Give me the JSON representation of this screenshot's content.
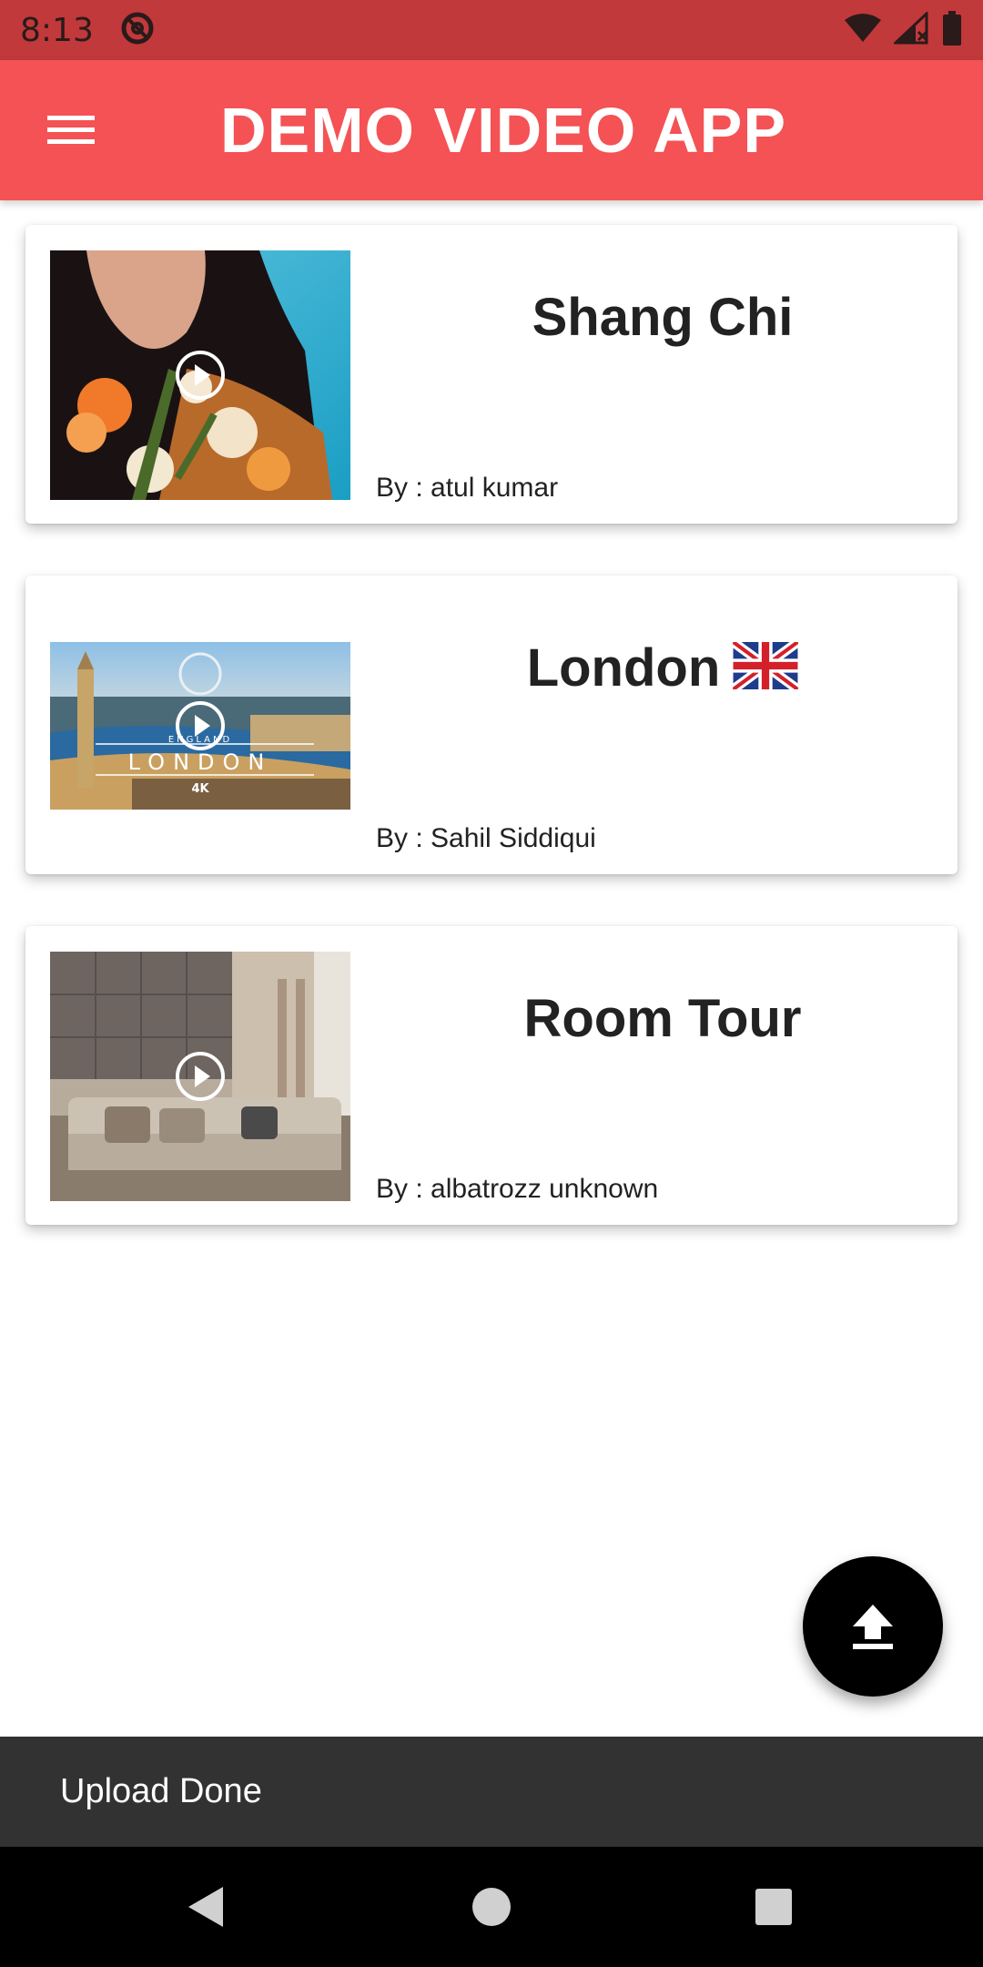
{
  "status_bar": {
    "time": "8:13",
    "icons": [
      "at-sign-icon",
      "wifi-icon",
      "signal-icon",
      "battery-icon"
    ]
  },
  "app_bar": {
    "title": "DEMO VIDEO APP",
    "menu_icon": "hamburger-menu-icon",
    "color": "#f45255"
  },
  "videos": [
    {
      "title": "Shang Chi",
      "author": "By : atul kumar",
      "thumbnail": "woman-with-flowers"
    },
    {
      "title": "London",
      "flag": "uk-flag",
      "author": "By : Sahil Siddiqui",
      "thumbnail": "london-aerial",
      "thumb_text": {
        "top": "ENGLAND",
        "main": "LONDON",
        "sub": "4K"
      }
    },
    {
      "title": "Room Tour",
      "author": "By : albatrozz unknown",
      "thumbnail": "living-room"
    }
  ],
  "fab": {
    "icon": "upload-icon"
  },
  "snackbar": {
    "message": "Upload Done"
  },
  "nav_bar": {
    "icons": [
      "back-icon",
      "home-icon",
      "recents-icon"
    ]
  }
}
